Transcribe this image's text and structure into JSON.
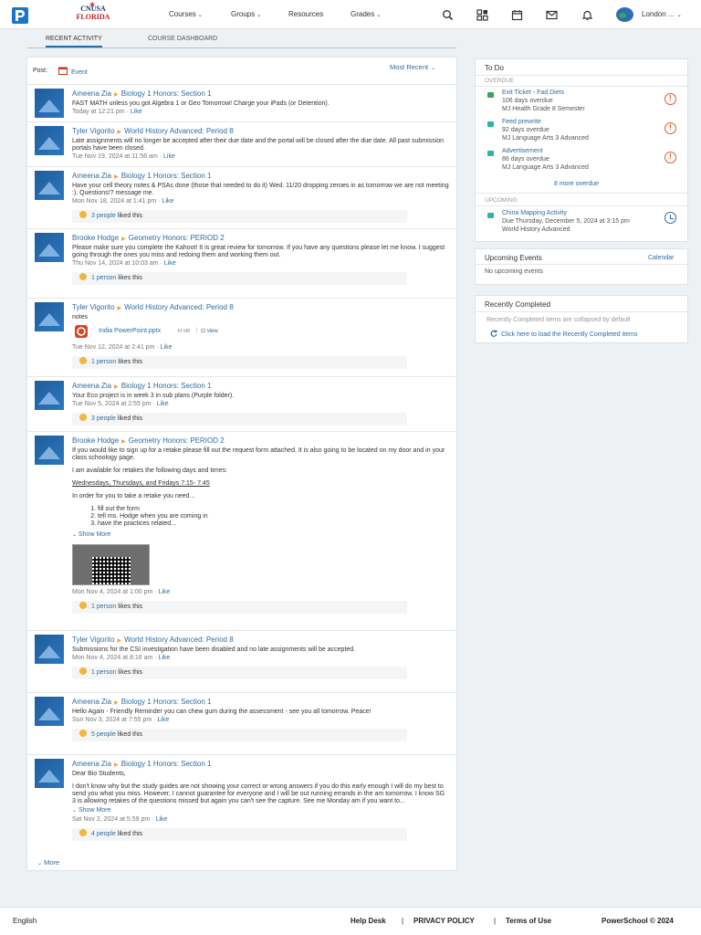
{
  "header": {
    "school_top": "CNUSA",
    "school_bottom": "FLORIDA",
    "nav": [
      "Courses",
      "Groups",
      "Resources",
      "Grades"
    ],
    "user_name": "London ...",
    "icons": [
      "search-icon",
      "apps-icon",
      "calendar-icon",
      "mail-icon",
      "bell-icon"
    ]
  },
  "tabs": [
    "RECENT ACTIVITY",
    "COURSE DASHBOARD"
  ],
  "post": {
    "label": "Post:",
    "event": "Event",
    "sort": "Most Recent"
  },
  "feed": [
    {
      "author": "Ameena Zia",
      "course": "Biology 1 Honors: Section 1",
      "text": "FAST MATH unless you got Algebra 1 or Geo Tomorrow! Charge your iPads (or Detention).",
      "time": "Today at 12:21 pm",
      "like": "Like"
    },
    {
      "author": "Tyler Vigorito",
      "course": "World History Advanced: Period 8",
      "text": "Late assignments will no longer be accepted after their due date and the portal will be closed after the due date. All past submission portals have been closed.",
      "time": "Tue Nov 19, 2024 at 11:56 am",
      "like": "Like"
    },
    {
      "author": "Ameena Zia",
      "course": "Biology 1 Honors: Section 1",
      "text": "Have your cell theory notes & PSAs done (those that needed to do it) Wed. 11/20  dropping zeroes in as tomorrow we are not meeting :). Questions!? message me.",
      "time": "Mon Nov 18, 2024 at 1:41 pm",
      "like": "Like",
      "likes_people": "3 people",
      "likes_suffix": "liked this"
    },
    {
      "author": "Brooke Hodge",
      "course": "Geometry Honors: PERIOD 2",
      "text": "Please make sure you complete the Kahoot! It is great review for tomorrow. If you have any questions please let me know. I suggest going through the ones you miss and redoing them and working them out.",
      "time": "Thu Nov 14, 2024 at 10:03 am",
      "like": "Like",
      "likes_people": "1 person",
      "likes_suffix": "likes this"
    },
    {
      "author": "Tyler Vigorito",
      "course": "World History Advanced: Period 8",
      "text": "notes",
      "attachment": {
        "name": "India PowerPoint.pptx",
        "size": "43 MB",
        "view": "view"
      },
      "time": "Tue Nov 12, 2024 at 2:41 pm",
      "like": "Like",
      "likes_people": "1 person",
      "likes_suffix": "likes this"
    },
    {
      "author": "Ameena Zia",
      "course": "Biology 1 Honors: Section 1",
      "text": "Your Eco project is in week 3 in sub plans (Purple folder).",
      "time": "Tue Nov 5, 2024 at 2:55 pm",
      "like": "Like",
      "likes_people": "3 people",
      "likes_suffix": "liked this"
    },
    {
      "author": "Brooke Hodge",
      "course": "Geometry Honors: PERIOD 2",
      "text": "If you would like to sign up for a retake please fill out the request form attached. It is also going to be located on my door and in your class schoology page.",
      "p2": "I am available for retakes the following days and times:",
      "p3": "Wednesdays, Thursdays, and Fridays 7:15- 7:45",
      "p4": "In order for you to take a retake you need...",
      "list": [
        "fill out the form",
        "tell ms. Hodge when you are coming in",
        "have the practices related..."
      ],
      "show_more": "Show More",
      "time": "Mon Nov 4, 2024 at 1:00 pm",
      "like": "Like",
      "likes_people": "1 person",
      "likes_suffix": "likes this"
    },
    {
      "author": "Tyler Vigorito",
      "course": "World History Advanced: Period 8",
      "text": "Submissions for the CSI investigation have been disabled and no late assignments will be accepted.",
      "time": "Mon Nov 4, 2024 at 8:16 am",
      "like": "Like",
      "likes_people": "1 person",
      "likes_suffix": "likes this"
    },
    {
      "author": "Ameena Zia",
      "course": "Biology 1 Honors: Section 1",
      "text": "Hello Again - Friendly Reminder you can chew gum during the assessment - see you all tomorrow. Peace!",
      "time": "Sun Nov 3, 2024 at 7:55 pm",
      "like": "Like",
      "likes_people": "5 people",
      "likes_suffix": "liked this"
    },
    {
      "author": "Ameena Zia",
      "course": "Biology 1 Honors: Section 1",
      "text": "Dear Bio Students,",
      "p2": "I don't know why but the study guides are not showing your correct or wrong answers if you do this early enough I will do my best to send you what you miss. However, I cannot guarantee for everyone and I will be out running errands in the am tomorrow. I know SG 3 is allowing retakes of the questions missed but again you can't see the capture. See me Monday am if you want to...",
      "show_more": "Show More",
      "time": "Sat Nov 2, 2024 at 5:59 pm",
      "like": "Like",
      "likes_people": "4 people",
      "likes_suffix": "liked this"
    }
  ],
  "more": "More",
  "todo": {
    "title": "To Do",
    "overdue": "OVERDUE",
    "items": [
      {
        "name": "Exit Ticket - Fad Diets",
        "status": "106 days overdue",
        "course": "MJ Health Grade 8 Semester"
      },
      {
        "name": "Feed prewrite",
        "status": "92 days overdue",
        "course": "MJ Language Arts 3 Advanced"
      },
      {
        "name": "Advertisement",
        "status": "86 days overdue",
        "course": "MJ Language Arts 3 Advanced"
      }
    ],
    "more_overdue": "8 more overdue",
    "upcoming": "UPCOMING",
    "upcoming_items": [
      {
        "name": "China Mapping Activity",
        "due": "Due Thursday, December 5, 2024 at 3:15 pm",
        "course": "World History Advanced"
      }
    ]
  },
  "events": {
    "title": "Upcoming Events",
    "calendar": "Calendar",
    "empty": "No upcoming events"
  },
  "completed": {
    "title": "Recently Completed",
    "note": "Recently Completed items are collapsed by default",
    "load": "Click here to load the Recently Completed items"
  },
  "footer": {
    "language": "English",
    "help": "Help Desk",
    "privacy": "PRIVACY POLICY",
    "terms": "Terms of Use",
    "brand": "PowerSchool © 2024"
  },
  "colors": {
    "link": "#2d6ca2",
    "overdue": "#e0592a",
    "brand_blue": "#1c74c9"
  }
}
